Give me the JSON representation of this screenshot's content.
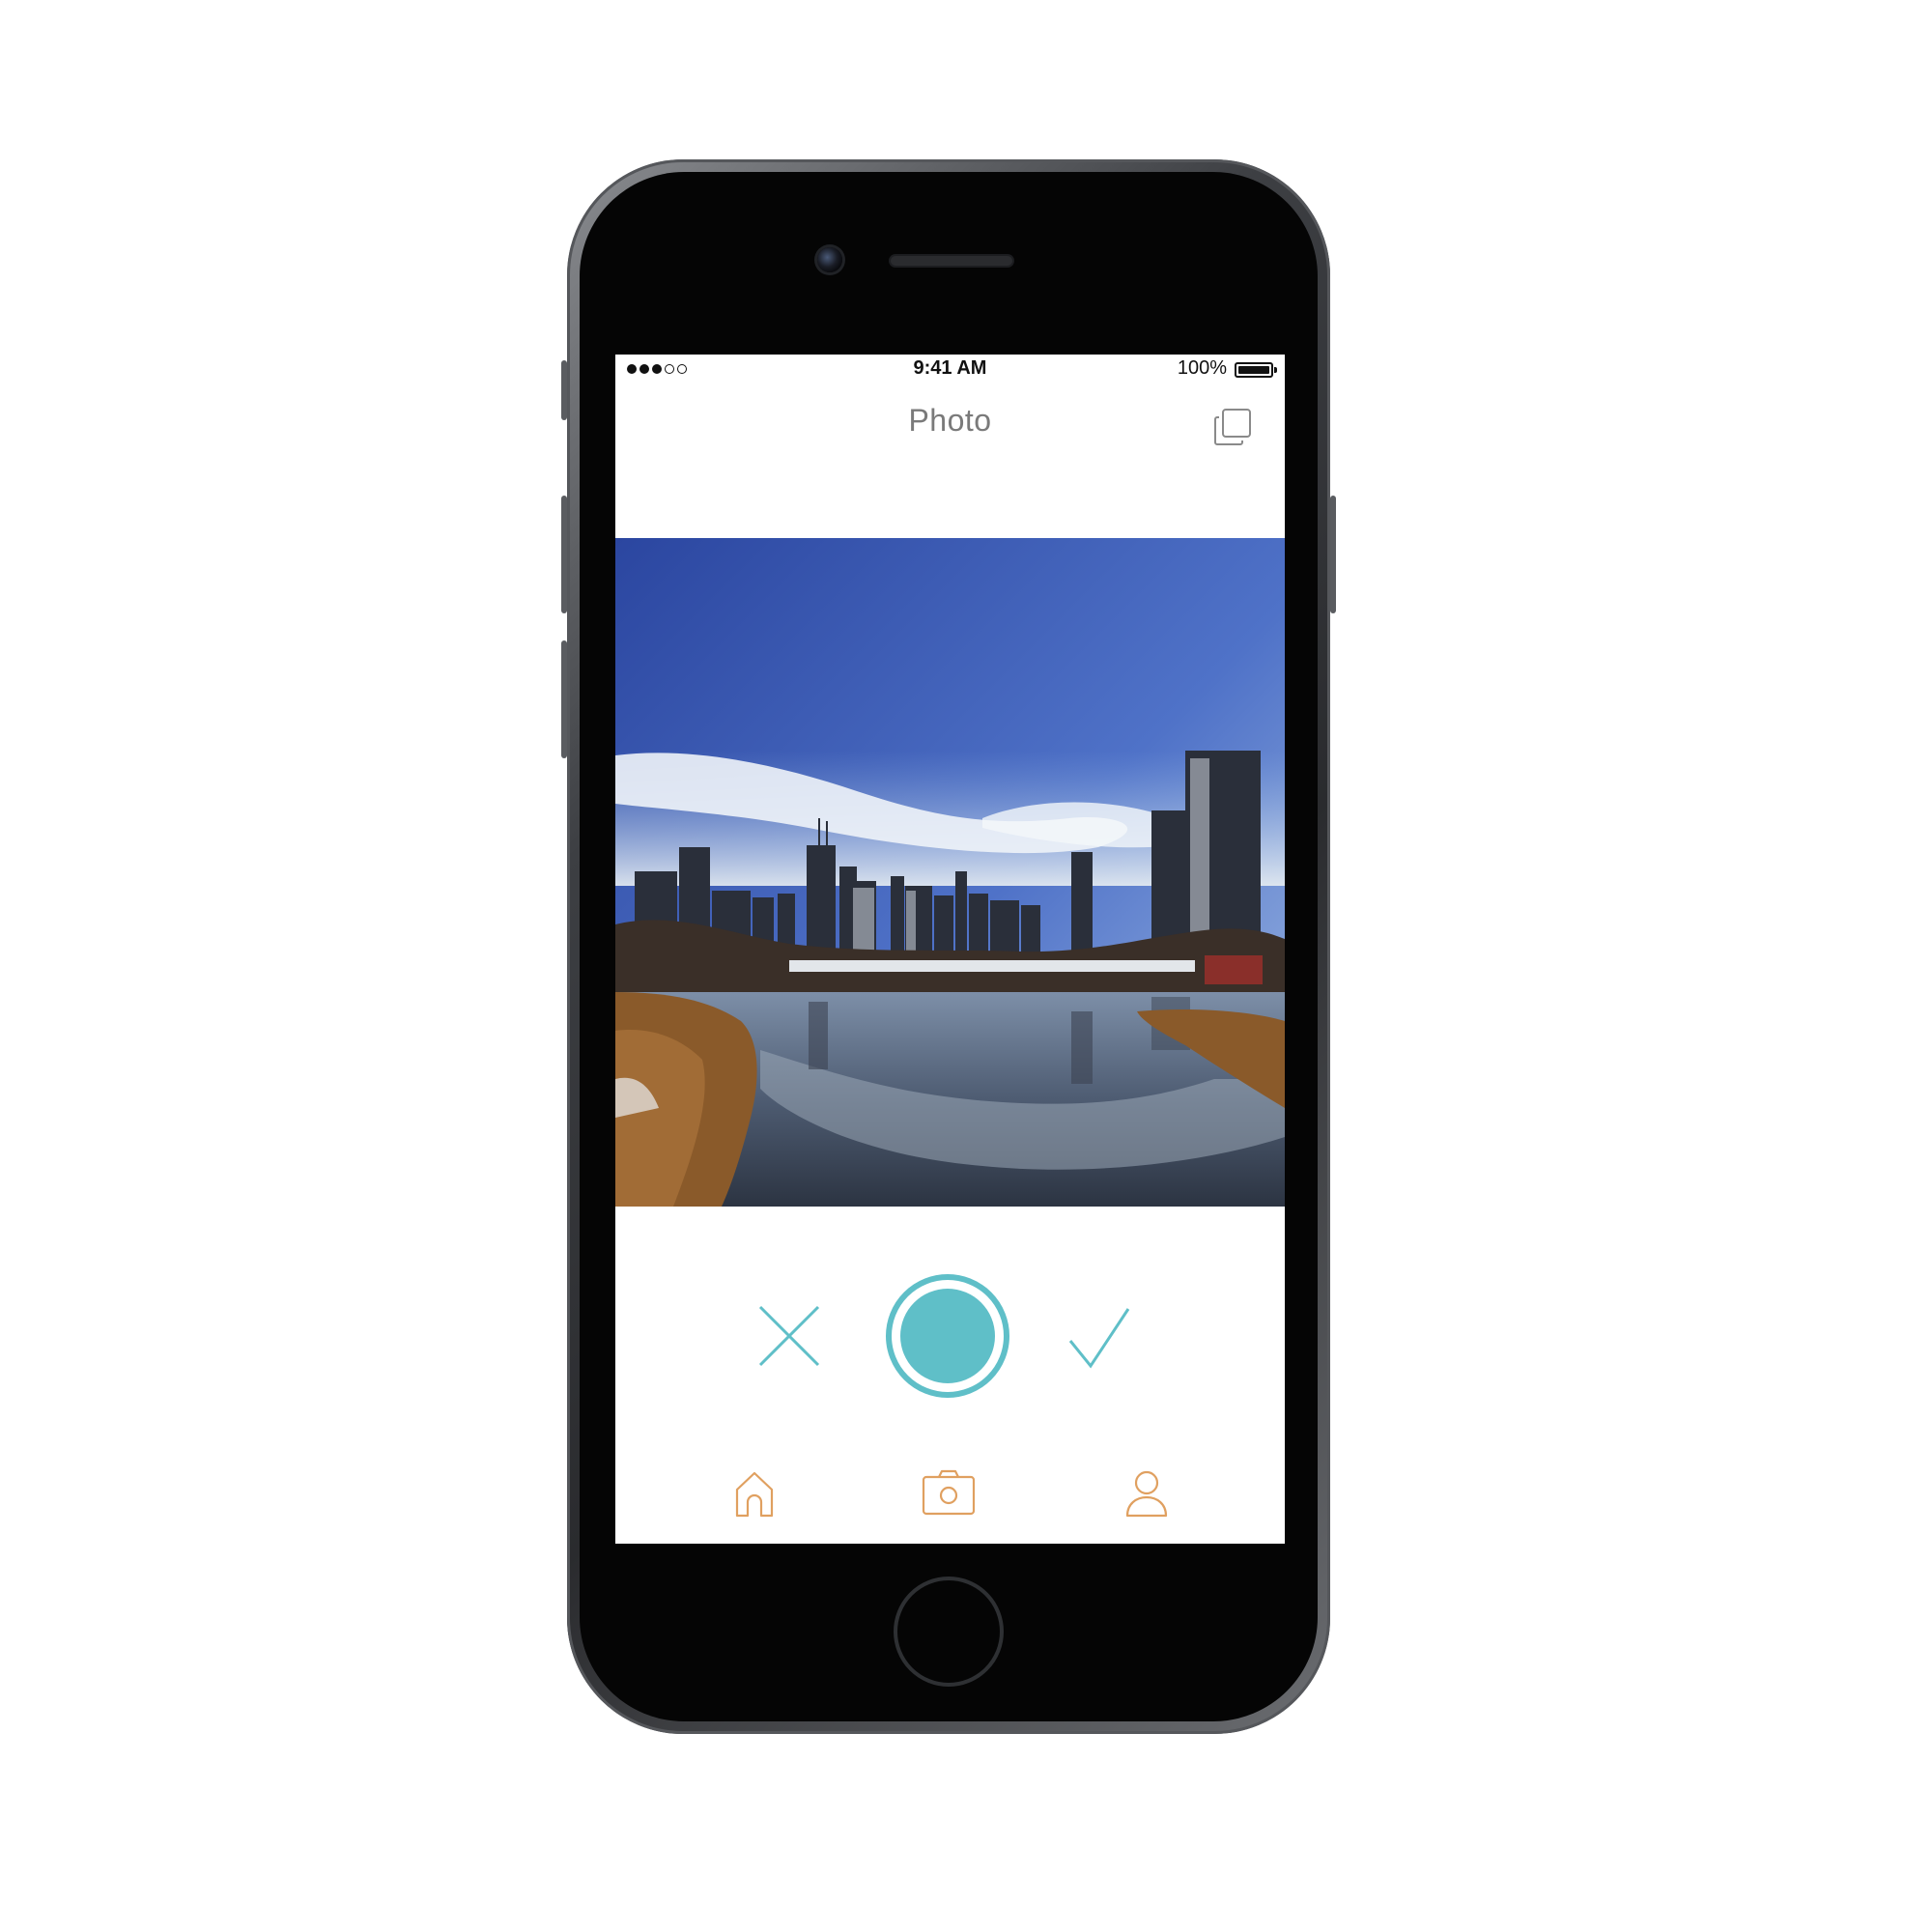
{
  "status_bar": {
    "signal": "●●●○○",
    "signal_bars": 3,
    "signal_total": 5,
    "time": "9:41 AM",
    "battery": "100%",
    "battery_level": 1.0
  },
  "nav": {
    "title": "Photo",
    "right_icon": "copy-icon"
  },
  "photo": {
    "description_icon": "photo-preview"
  },
  "controls": {
    "cancel_icon": "close-icon",
    "shutter_icon": "shutter-button",
    "confirm_icon": "checkmark-icon"
  },
  "tab_bar": {
    "items": [
      "home-icon",
      "camera-icon",
      "profile-icon"
    ]
  },
  "colors": {
    "accent": "#5fbfc8",
    "tab_icon": "#e0a060",
    "title_text": "#7a7a7a"
  }
}
